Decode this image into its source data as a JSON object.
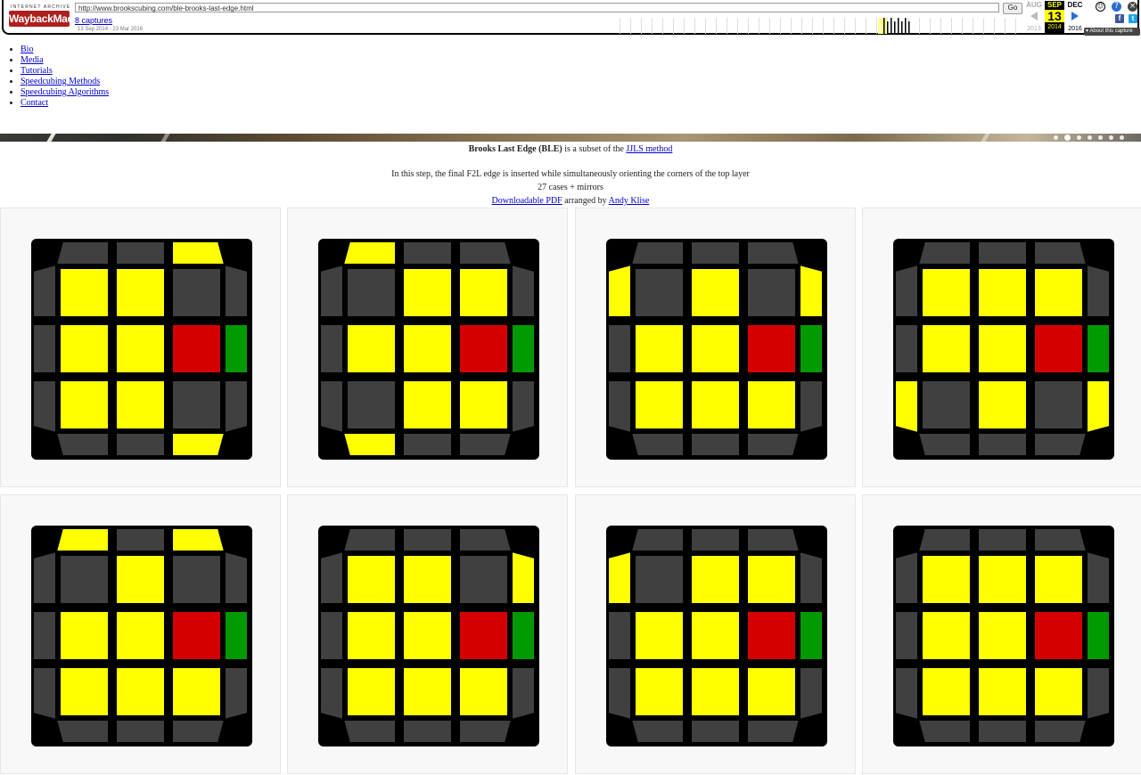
{
  "wayback": {
    "brand_top": "INTERNET ARCHIVE",
    "brand_main": "WaybackMachine",
    "url": "http://www.brookscubing.com/ble-brooks-last-edge.html",
    "go_label": "Go",
    "captures": "8 captures",
    "range": "13 Sep 2014 - 23 Mar 2016",
    "prev_month": "AUG",
    "prev_year": "2013",
    "cur_month": "SEP",
    "cur_day": "13",
    "cur_year": "2014",
    "next_month": "DEC",
    "next_year": "2016",
    "about": "About this capture"
  },
  "nav": {
    "items": [
      "Bio",
      "Media",
      "Tutorials",
      "Speedcubing Methods",
      "Speedcubing Algorithms",
      "Contact"
    ]
  },
  "intro": {
    "title_bold": "Brooks Last Edge (BLE)",
    "subset_text": " is a subset of the ",
    "jjls_link": "JJLS method",
    "line2": "In this step, the final F2L edge is inserted while simultaneously orienting the corners of the top layer",
    "line3": "27 cases + mirrors",
    "pdf_link": "Downloadable PDF",
    "arranged_by": " arranged by ",
    "author_link": "Andy Klise"
  },
  "colors": {
    "yellow": "#ffff00",
    "grey": "#404040",
    "red": "#d40000",
    "green": "#009900",
    "outline": "#000000"
  },
  "cases": [
    {
      "top": [
        "g",
        "g",
        "y"
      ],
      "left": [
        "g",
        "g",
        "g"
      ],
      "right": [
        "g",
        "G",
        "g"
      ],
      "bottom": [
        "g",
        "g",
        "y"
      ],
      "face": [
        [
          "y",
          "y",
          "g"
        ],
        [
          "y",
          "y",
          "r"
        ],
        [
          "y",
          "y",
          "g"
        ]
      ]
    },
    {
      "top": [
        "y",
        "g",
        "g"
      ],
      "left": [
        "g",
        "g",
        "g"
      ],
      "right": [
        "g",
        "G",
        "g"
      ],
      "bottom": [
        "y",
        "g",
        "g"
      ],
      "face": [
        [
          "g",
          "y",
          "y"
        ],
        [
          "y",
          "y",
          "r"
        ],
        [
          "g",
          "y",
          "y"
        ]
      ]
    },
    {
      "top": [
        "g",
        "g",
        "g"
      ],
      "left": [
        "y",
        "g",
        "g"
      ],
      "right": [
        "y",
        "G",
        "g"
      ],
      "bottom": [
        "g",
        "g",
        "g"
      ],
      "face": [
        [
          "g",
          "y",
          "g"
        ],
        [
          "y",
          "y",
          "r"
        ],
        [
          "y",
          "y",
          "y"
        ]
      ]
    },
    {
      "top": [
        "g",
        "g",
        "g"
      ],
      "left": [
        "g",
        "g",
        "y"
      ],
      "right": [
        "g",
        "G",
        "y"
      ],
      "bottom": [
        "g",
        "g",
        "g"
      ],
      "face": [
        [
          "y",
          "y",
          "y"
        ],
        [
          "y",
          "y",
          "r"
        ],
        [
          "g",
          "y",
          "g"
        ]
      ]
    },
    {
      "top": [
        "y",
        "g",
        "y"
      ],
      "left": [
        "g",
        "g",
        "g"
      ],
      "right": [
        "g",
        "G",
        "g"
      ],
      "bottom": [
        "g",
        "g",
        "g"
      ],
      "face": [
        [
          "g",
          "y",
          "g"
        ],
        [
          "y",
          "y",
          "r"
        ],
        [
          "y",
          "y",
          "y"
        ]
      ]
    },
    {
      "top": [
        "g",
        "g",
        "g"
      ],
      "left": [
        "g",
        "g",
        "g"
      ],
      "right": [
        "y",
        "G",
        "g"
      ],
      "bottom": [
        "g",
        "g",
        "g"
      ],
      "face": [
        [
          "y",
          "y",
          "g"
        ],
        [
          "y",
          "y",
          "r"
        ],
        [
          "y",
          "y",
          "y"
        ]
      ]
    },
    {
      "top": [
        "g",
        "g",
        "g"
      ],
      "left": [
        "y",
        "g",
        "g"
      ],
      "right": [
        "g",
        "G",
        "g"
      ],
      "bottom": [
        "g",
        "g",
        "g"
      ],
      "face": [
        [
          "g",
          "y",
          "y"
        ],
        [
          "y",
          "y",
          "r"
        ],
        [
          "y",
          "y",
          "y"
        ]
      ]
    },
    {
      "top": [
        "g",
        "g",
        "g"
      ],
      "left": [
        "g",
        "g",
        "g"
      ],
      "right": [
        "g",
        "G",
        "g"
      ],
      "bottom": [
        "g",
        "g",
        "g"
      ],
      "face": [
        [
          "y",
          "y",
          "y"
        ],
        [
          "y",
          "y",
          "r"
        ],
        [
          "y",
          "y",
          "y"
        ]
      ]
    }
  ]
}
